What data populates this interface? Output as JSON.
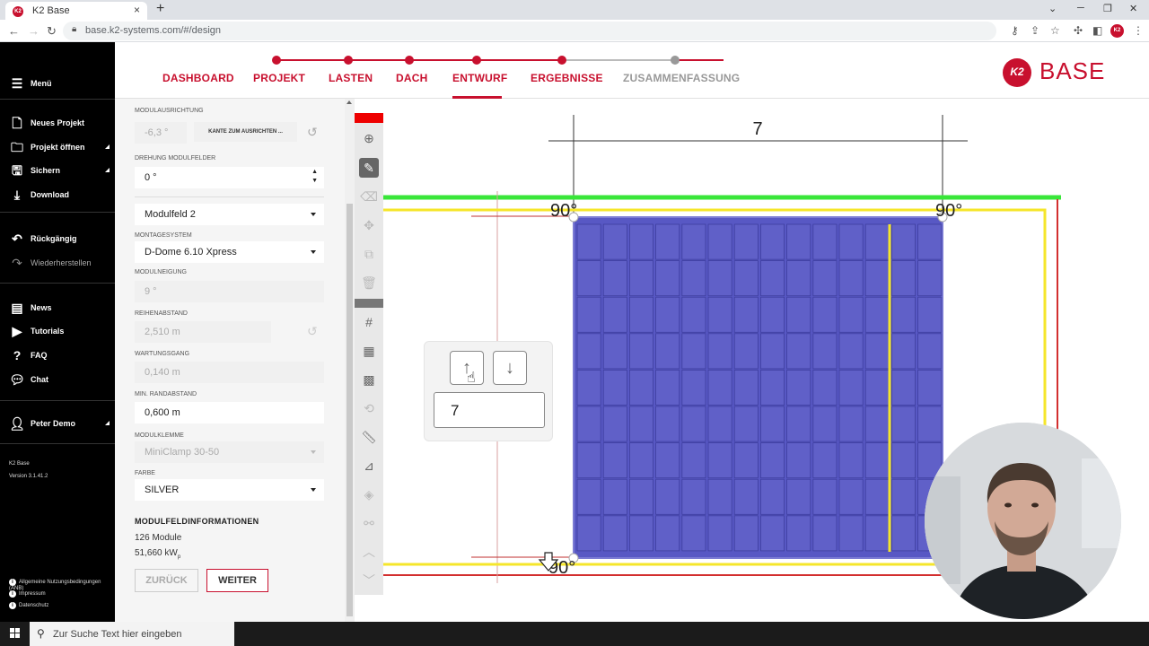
{
  "browser": {
    "tab_title": "K2 Base",
    "tab_icon": "K2",
    "url": "base.k2-systems.com/#/design"
  },
  "sidebar": {
    "menu_label": "Menü",
    "items": [
      {
        "label": "Neues Projekt",
        "icon": "new-project-icon"
      },
      {
        "label": "Projekt öffnen",
        "icon": "folder-icon"
      },
      {
        "label": "Sichern",
        "icon": "save-icon"
      },
      {
        "label": "Download",
        "icon": "download-icon"
      },
      {
        "label": "Rückgängig",
        "icon": "undo-icon"
      },
      {
        "label": "Wiederherstellen",
        "icon": "redo-icon"
      },
      {
        "label": "News",
        "icon": "news-icon"
      },
      {
        "label": "Tutorials",
        "icon": "tutorials-icon"
      },
      {
        "label": "FAQ",
        "icon": "faq-icon"
      },
      {
        "label": "Chat",
        "icon": "chat-icon"
      },
      {
        "label": "Peter Demo",
        "icon": "user-icon"
      }
    ],
    "app_name": "K2 Base",
    "version": "Version 3.1.41.2",
    "footer": [
      "Allgemeine Nutzungsbedingungen (ANB)",
      "Impressum",
      "Datenschutz"
    ]
  },
  "nav": {
    "steps": [
      {
        "label": "DASHBOARD",
        "state": "done"
      },
      {
        "label": "PROJEKT",
        "state": "done"
      },
      {
        "label": "LASTEN",
        "state": "done"
      },
      {
        "label": "DACH",
        "state": "done"
      },
      {
        "label": "ENTWURF",
        "state": "active"
      },
      {
        "label": "ERGEBNISSE",
        "state": "done"
      },
      {
        "label": "ZUSAMMENFASSUNG",
        "state": "pending"
      }
    ],
    "logo_mark": "K2",
    "logo_text": "BASE",
    "accent_color": "#c8102e"
  },
  "panel": {
    "modulausrichtung": {
      "label": "MODULAUSRICHTUNG",
      "value": "-6,3 °",
      "button": "KANTE ZUM AUSRICHTEN ..."
    },
    "drehung": {
      "label": "DREHUNG MODULFELDER",
      "value": "0 °"
    },
    "modulfeld": {
      "value": "Modulfeld 2"
    },
    "montagesystem": {
      "label": "MONTAGESYSTEM",
      "value": "D-Dome 6.10 Xpress"
    },
    "modulneigung": {
      "label": "MODULNEIGUNG",
      "value": "9 °"
    },
    "reihenabstand": {
      "label": "REIHENABSTAND",
      "value": "2,510 m"
    },
    "wartungsgang": {
      "label": "WARTUNGSGANG",
      "value": "0,140 m"
    },
    "randabstand": {
      "label": "MIN. RANDABSTAND",
      "value": "0,600 m"
    },
    "modulklemme": {
      "label": "MODULKLEMME",
      "value": "MiniClamp 30-50"
    },
    "farbe": {
      "label": "FARBE",
      "value": "SILVER"
    },
    "info_title": "MODULFELDINFORMATIONEN",
    "module_count": "126 Module",
    "power": "51,660 kW",
    "power_sub": "p",
    "back_button": "ZURÜCK",
    "next_button": "WEITER"
  },
  "tools": [
    "add-icon",
    "pencil-icon",
    "eraser-icon",
    "move-icon",
    "copy-icon",
    "trash-icon",
    "grid-hash-icon",
    "grid-icon",
    "grid-settings-icon",
    "rotate-icon",
    "ruler-icon",
    "measure-icon",
    "layers-icon",
    "link-icon",
    "chevron-up-icon",
    "chevron-down-icon"
  ],
  "canvas": {
    "dimension_label": "7",
    "angle_labels": [
      "90°",
      "90°",
      "90°"
    ],
    "stepper_value": "7",
    "module_color": "#6060c8",
    "roof_edge_color": "#d32f2f",
    "boundary_color": "#f5e62a",
    "edge_highlight_color": "#39e639"
  },
  "taskbar": {
    "search_placeholder": "Zur Suche Text hier eingeben"
  }
}
